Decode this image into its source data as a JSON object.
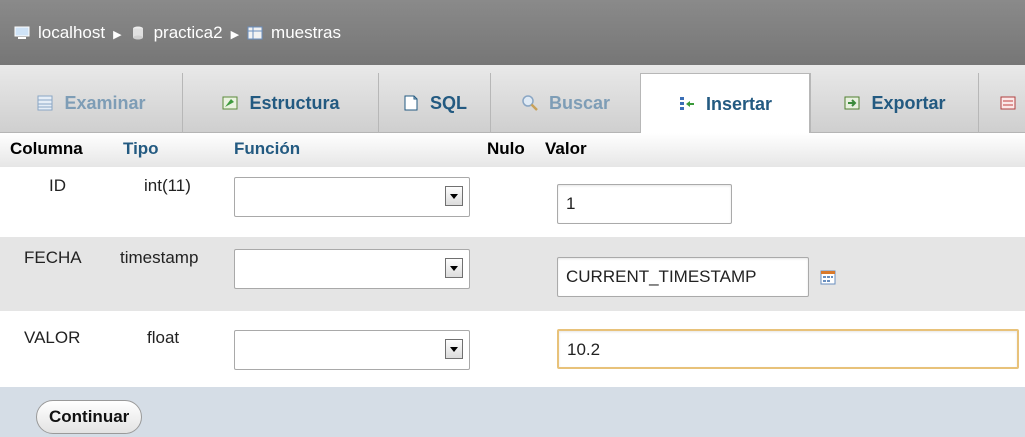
{
  "breadcrumb": {
    "items": [
      {
        "label": "localhost",
        "icon": "server-icon"
      },
      {
        "label": "practica2",
        "icon": "database-icon"
      },
      {
        "label": "muestras",
        "icon": "table-icon"
      }
    ],
    "separator": "▶"
  },
  "tabs": [
    {
      "label": "Examinar",
      "icon": "browse-icon",
      "state": "disabled"
    },
    {
      "label": "Estructura",
      "icon": "structure-icon",
      "state": "normal"
    },
    {
      "label": "SQL",
      "icon": "sql-icon",
      "state": "normal"
    },
    {
      "label": "Buscar",
      "icon": "search-icon",
      "state": "disabled"
    },
    {
      "label": "Insertar",
      "icon": "insert-icon",
      "state": "active"
    },
    {
      "label": "Exportar",
      "icon": "export-icon",
      "state": "normal"
    }
  ],
  "table": {
    "headers": {
      "column": "Columna",
      "type": "Tipo",
      "function": "Función",
      "null": "Nulo",
      "value": "Valor"
    },
    "rows": [
      {
        "column": "ID",
        "type": "int(11)",
        "function": "",
        "value": "1"
      },
      {
        "column": "FECHA",
        "type": "timestamp",
        "function": "",
        "value": "CURRENT_TIMESTAMP"
      },
      {
        "column": "VALOR",
        "type": "float",
        "function": "",
        "value": "10.2"
      }
    ]
  },
  "footer": {
    "continue_label": "Continuar"
  },
  "colors": {
    "link": "#235a81",
    "header_bar": "#808080",
    "footer": "#d5dde6",
    "focus": "#e8c27a"
  }
}
